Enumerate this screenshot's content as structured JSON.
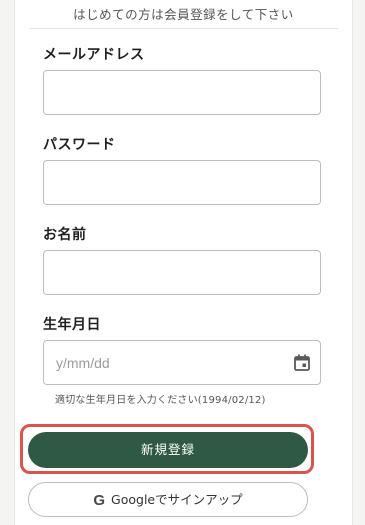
{
  "header": {
    "notice": "はじめての方は会員登録をして下さい"
  },
  "form": {
    "email": {
      "label": "メールアドレス",
      "value": ""
    },
    "password": {
      "label": "パスワード",
      "value": ""
    },
    "name": {
      "label": "お名前",
      "value": ""
    },
    "birthdate": {
      "label": "生年月日",
      "placeholder": "y/mm/dd",
      "hint": "適切な生年月日を入力ください(1994/02/12)",
      "icon": "calendar-icon"
    }
  },
  "buttons": {
    "register_label": "新規登録",
    "google_label": "Googleでサインアップ",
    "google_icon": "G",
    "register_color": "#2f5944",
    "highlight_color": "#d9534f"
  }
}
